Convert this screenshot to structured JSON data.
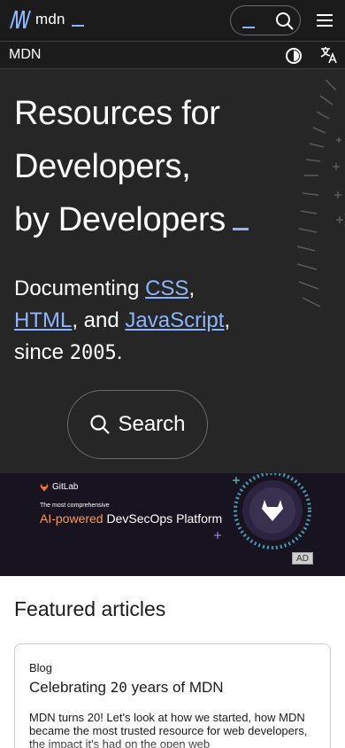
{
  "header": {
    "logo_text": "mdn",
    "subbar_title": "MDN"
  },
  "hero": {
    "title_line1": "Resources for",
    "title_line2": "Developers,",
    "title_line3": "by Developers",
    "tag_prefix": "Documenting ",
    "link_css": "CSS",
    "sep1": ",",
    "link_html": "HTML",
    "sep2": ", and ",
    "link_js": "JavaScript",
    "sep3": ",",
    "since_prefix": "since ",
    "year": "2005",
    "since_suffix": ".",
    "search_label": "Search"
  },
  "ad": {
    "brand": "GitLab",
    "small_text": "The most comprehensive",
    "headline_accent": "AI-powered",
    "headline_rest": " DevSecOps Platform",
    "badge": "AD"
  },
  "featured": {
    "heading": "Featured articles",
    "articles": [
      {
        "kicker": "Blog",
        "title_prefix": "Celebrating ",
        "title_number": "20",
        "title_suffix": " years of MDN",
        "description": "MDN turns 20! Let's look at how we started, how MDN became the most trusted resource for web developers, the impact it's had on the open web"
      }
    ]
  },
  "colors": {
    "accent": "#8cb4ff",
    "dark_bg": "#1b1b1b",
    "hero_bg": "#262626",
    "ad_bg": "#171321"
  }
}
